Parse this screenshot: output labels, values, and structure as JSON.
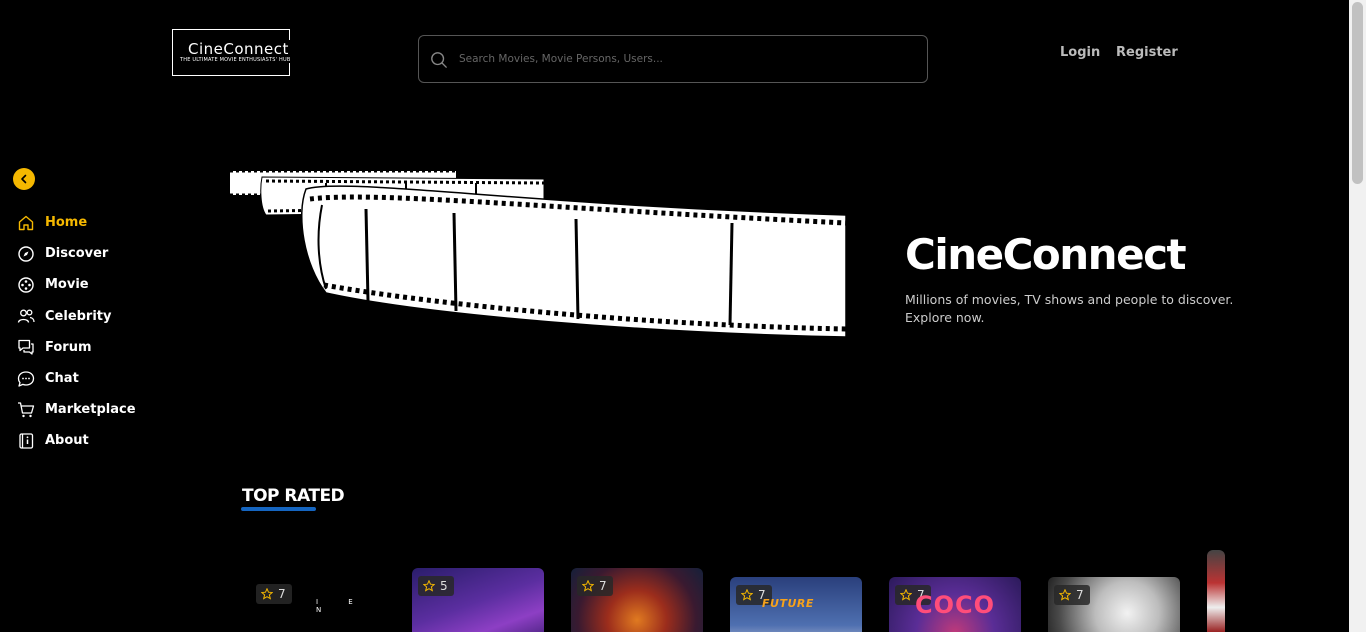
{
  "header": {
    "logo_name": "CineConnect",
    "logo_tagline": "THE ULTIMATE MOVIE ENTHUSIASTS' HUB",
    "search_placeholder": "Search Movies, Movie Persons, Users...",
    "login_label": "Login",
    "register_label": "Register"
  },
  "sidebar": {
    "collapse_icon": "chevron-left-icon",
    "items": [
      {
        "label": "Home",
        "icon": "home-icon",
        "active": true
      },
      {
        "label": "Discover",
        "icon": "compass-icon"
      },
      {
        "label": "Movie",
        "icon": "film-reel-icon"
      },
      {
        "label": "Celebrity",
        "icon": "users-icon"
      },
      {
        "label": "Forum",
        "icon": "forum-icon"
      },
      {
        "label": "Chat",
        "icon": "chat-icon"
      },
      {
        "label": "Marketplace",
        "icon": "cart-icon"
      },
      {
        "label": "About",
        "icon": "info-book-icon"
      }
    ]
  },
  "hero": {
    "title": "CineConnect",
    "subtitle": "Millions of movies, TV shows and people to discover. Explore now."
  },
  "top_rated": {
    "title": "TOP RATED",
    "cards": [
      {
        "rating": "7",
        "poster_text": "I E N"
      },
      {
        "rating": "5"
      },
      {
        "rating": "7"
      },
      {
        "rating": "7",
        "poster_text": "FUTURE"
      },
      {
        "rating": "7",
        "poster_text": "COCO"
      },
      {
        "rating": "7"
      }
    ]
  },
  "colors": {
    "accent": "#f5b800",
    "underline": "#1565c0",
    "background": "#000000"
  }
}
